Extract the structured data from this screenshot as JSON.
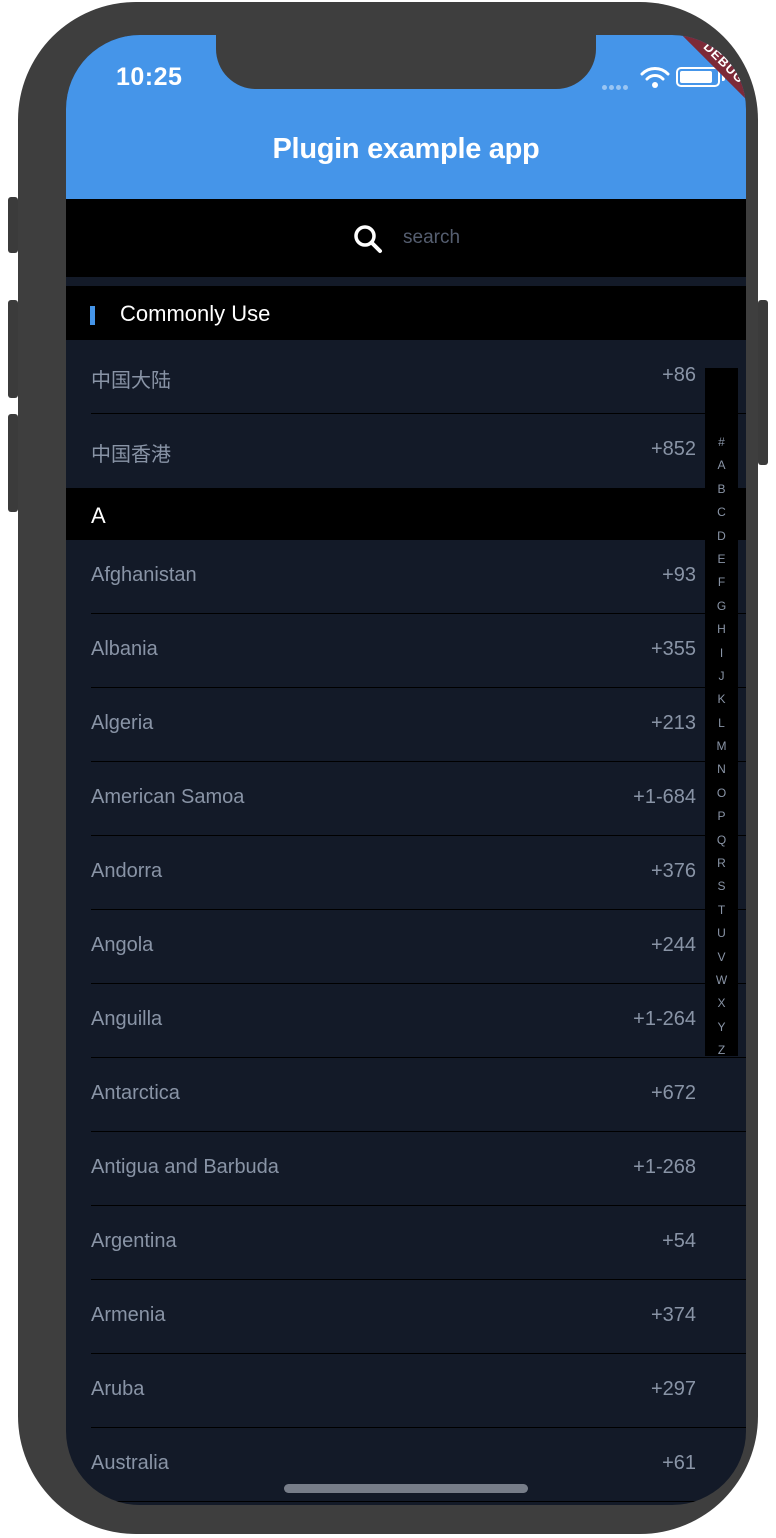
{
  "status_bar": {
    "time": "10:25",
    "debug_label": "DEBUG"
  },
  "app_bar": {
    "title": "Plugin example app"
  },
  "search": {
    "placeholder": "search"
  },
  "common_section": {
    "title": "Commonly Use",
    "items": [
      {
        "name": "中国大陆",
        "code": "+86"
      },
      {
        "name": "中国香港",
        "code": "+852"
      }
    ]
  },
  "section_a": {
    "title": "A",
    "items": [
      {
        "name": "Afghanistan",
        "code": "+93"
      },
      {
        "name": "Albania",
        "code": "+355"
      },
      {
        "name": "Algeria",
        "code": "+213"
      },
      {
        "name": "American Samoa",
        "code": "+1-684"
      },
      {
        "name": "Andorra",
        "code": "+376"
      },
      {
        "name": "Angola",
        "code": "+244"
      },
      {
        "name": "Anguilla",
        "code": "+1-264"
      },
      {
        "name": "Antarctica",
        "code": "+672"
      },
      {
        "name": "Antigua and Barbuda",
        "code": "+1-268"
      },
      {
        "name": "Argentina",
        "code": "+54"
      },
      {
        "name": "Armenia",
        "code": "+374"
      },
      {
        "name": "Aruba",
        "code": "+297"
      },
      {
        "name": "Australia",
        "code": "+61"
      }
    ]
  },
  "index_bar": {
    "letters": [
      "#",
      "A",
      "B",
      "C",
      "D",
      "E",
      "F",
      "G",
      "H",
      "I",
      "J",
      "K",
      "L",
      "M",
      "N",
      "O",
      "P",
      "Q",
      "R",
      "S",
      "T",
      "U",
      "V",
      "W",
      "X",
      "Y",
      "Z"
    ]
  },
  "colors": {
    "accent": "#4595e9",
    "background": "#131a28",
    "header": "#000000",
    "text_muted": "#8994a6",
    "debug_banner": "#7d2a38"
  }
}
